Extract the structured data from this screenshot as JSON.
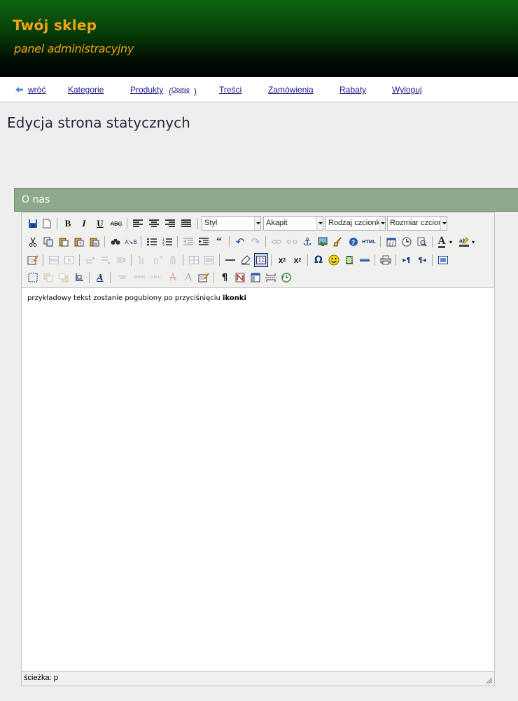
{
  "header": {
    "title": "Twój sklep",
    "subtitle": "panel administracyjny"
  },
  "nav": {
    "back": "wróć",
    "categories": "Kategorie",
    "products": "Produkty",
    "products_paren_open": "(",
    "reviews": "Opinie",
    "products_paren_close": ")",
    "content": "Treści",
    "orders": "Zamówienia",
    "discounts": "Rabaty",
    "logout": "Wyloguj"
  },
  "page": {
    "title": "Edycja strona statycznych"
  },
  "panel": {
    "title": "O nas"
  },
  "editor": {
    "style_select": "Styl",
    "format_select": "Akapit",
    "font_family_select": "Rodzaj czcionki",
    "font_size_select": "Rozmiar czcionki",
    "content_text": "przykładowy tekst zostanie pogubiony po przyciśnięciu ",
    "content_bold": "ikonki",
    "path_label": "ścieżka: p"
  },
  "icons": {
    "row1": [
      "save-icon",
      "new-document-icon",
      "bold-icon",
      "italic-icon",
      "underline-icon",
      "strikethrough-icon",
      "align-left-icon",
      "align-center-icon",
      "align-right-icon",
      "align-justify-icon"
    ],
    "row2": [
      "cut-icon",
      "copy-icon",
      "paste-icon",
      "paste-text-icon",
      "paste-word-icon",
      "find-icon",
      "replace-icon",
      "bullet-list-icon",
      "numbered-list-icon",
      "outdent-icon",
      "indent-icon",
      "blockquote-icon",
      "undo-icon",
      "redo-icon",
      "link-icon",
      "unlink-icon",
      "anchor-icon",
      "image-icon",
      "cleanup-icon",
      "help-icon",
      "html-icon",
      "insert-date-icon",
      "insert-time-icon",
      "preview-icon",
      "text-color-icon",
      "background-color-icon"
    ],
    "row3": [
      "edit-css-icon",
      "table-row-props-icon",
      "table-cell-props-icon",
      "row-before-icon",
      "row-after-icon",
      "delete-row-icon",
      "col-before-icon",
      "col-after-icon",
      "delete-col-icon",
      "split-cells-icon",
      "merge-cells-icon",
      "horizontal-rule-icon",
      "remove-format-icon",
      "visual-aid-icon",
      "subscript-icon",
      "superscript-icon",
      "special-char-icon",
      "emoticon-icon",
      "media-icon",
      "advanced-hr-icon",
      "print-icon",
      "ltr-icon",
      "rtl-icon",
      "fullscreen-icon"
    ],
    "row4": [
      "insert-layer-icon",
      "move-forward-icon",
      "move-backward-icon",
      "absolute-icon",
      "styleprops-icon",
      "cite-icon",
      "abbr-icon",
      "acronym-icon",
      "del-icon",
      "ins-icon",
      "attribs-icon",
      "visual-chars-icon",
      "nonbreaking-icon",
      "template-icon",
      "pagebreak-icon",
      "restore-draft-icon"
    ]
  },
  "colors": {
    "accent": "#f1a315",
    "panel_header": "#8fa98c",
    "link": "#1a1a88"
  }
}
